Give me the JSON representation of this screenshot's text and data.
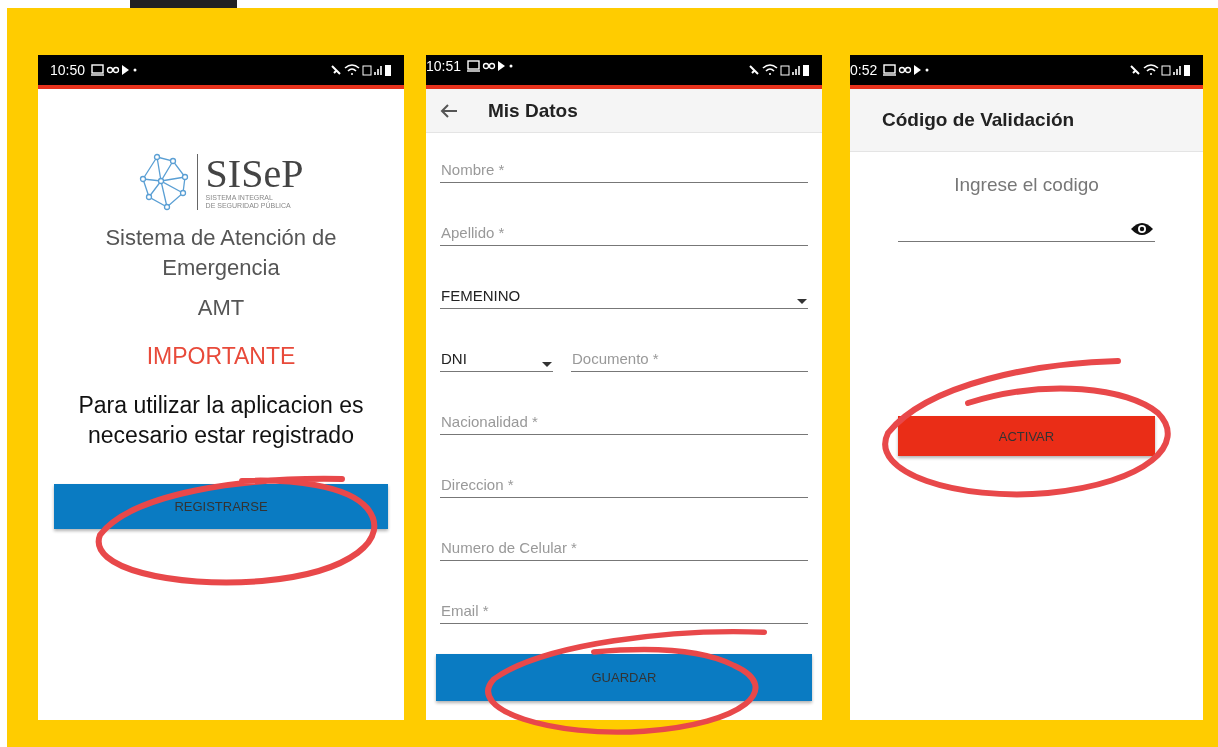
{
  "phones": [
    {
      "kind": "welcome",
      "status_time": "10:50",
      "logo": {
        "name": "SISeP",
        "subtitle_lines": [
          "SISTEMA INTEGRAL",
          "DE SEGURIDAD PÚBLICA"
        ]
      },
      "title": "Sistema de Atención de Emergencia",
      "app_code": "AMT",
      "notice": "IMPORTANTE",
      "message": "Para utilizar la aplicacion es necesario estar registrado",
      "button": "REGISTRARSE"
    },
    {
      "kind": "form",
      "status_time": "10:51",
      "title": "Mis Datos",
      "fields": [
        {
          "kind": "text",
          "placeholder": "Nombre *"
        },
        {
          "kind": "text",
          "placeholder": "Apellido *"
        },
        {
          "kind": "select",
          "value": "FEMENINO"
        },
        {
          "kind": "pair",
          "parts": [
            {
              "kind": "select",
              "value": "DNI"
            },
            {
              "kind": "text",
              "placeholder": "Documento *"
            }
          ]
        },
        {
          "kind": "text",
          "placeholder": "Nacionalidad *"
        },
        {
          "kind": "text",
          "placeholder": "Direccion *"
        },
        {
          "kind": "text",
          "placeholder": "Numero de Celular *"
        },
        {
          "kind": "text",
          "placeholder": "Email *"
        }
      ],
      "button": "GUARDAR"
    },
    {
      "kind": "validation",
      "status_time": "0:52",
      "title": "Código de Validación",
      "prompt": "Ingrese el codigo",
      "button": "ACTIVAR"
    }
  ]
}
